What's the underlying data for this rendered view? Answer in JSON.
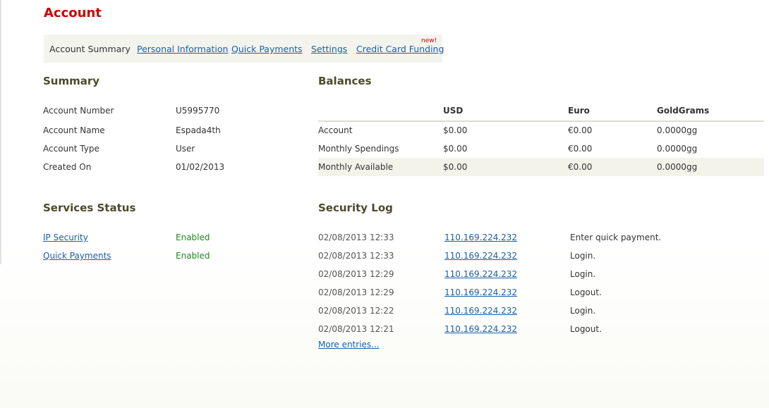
{
  "page": {
    "title": "Account"
  },
  "tabs": {
    "items": [
      {
        "label": "Account Summary",
        "active": true
      },
      {
        "label": "Personal Information"
      },
      {
        "label": "Quick Payments"
      },
      {
        "label": "Settings"
      },
      {
        "label": "Credit Card Funding"
      }
    ],
    "new_badge": "new!"
  },
  "summary": {
    "title": "Summary",
    "rows": [
      {
        "label": "Account Number",
        "value": "U5995770"
      },
      {
        "label": "Account Name",
        "value": "Espada4th"
      },
      {
        "label": "Account Type",
        "value": "User"
      },
      {
        "label": "Created On",
        "value": "01/02/2013"
      }
    ]
  },
  "balances": {
    "title": "Balances",
    "headers": [
      "USD",
      "Euro",
      "GoldGrams"
    ],
    "rows": [
      {
        "label": "Account",
        "usd": "$0.00",
        "euro": "€0.00",
        "gold": "0.0000gg"
      },
      {
        "label": "Monthly Spendings",
        "usd": "$0.00",
        "euro": "€0.00",
        "gold": "0.0000gg"
      },
      {
        "label": "Monthly Available",
        "usd": "$0.00",
        "euro": "€0.00",
        "gold": "0.0000gg"
      }
    ]
  },
  "services": {
    "title": "Services Status",
    "rows": [
      {
        "label": "IP Security",
        "status": "Enabled"
      },
      {
        "label": "Quick Payments",
        "status": "Enabled"
      }
    ]
  },
  "security_log": {
    "title": "Security Log",
    "rows": [
      {
        "date": "02/08/2013 12:33",
        "ip": "110.169.224.232",
        "event": "Enter quick payment."
      },
      {
        "date": "02/08/2013 12:33",
        "ip": "110.169.224.232",
        "event": "Login."
      },
      {
        "date": "02/08/2013 12:29",
        "ip": "110.169.224.232",
        "event": "Login."
      },
      {
        "date": "02/08/2013 12:29",
        "ip": "110.169.224.232",
        "event": "Logout."
      },
      {
        "date": "02/08/2013 12:22",
        "ip": "110.169.224.232",
        "event": "Login."
      },
      {
        "date": "02/08/2013 12:21",
        "ip": "110.169.224.232",
        "event": "Logout."
      }
    ],
    "more_label": "More entries..."
  },
  "colors": {
    "title": "#cc0000",
    "link": "#1a5fa8",
    "enabled": "#1f8a1f",
    "section": "#4b4b2a"
  }
}
